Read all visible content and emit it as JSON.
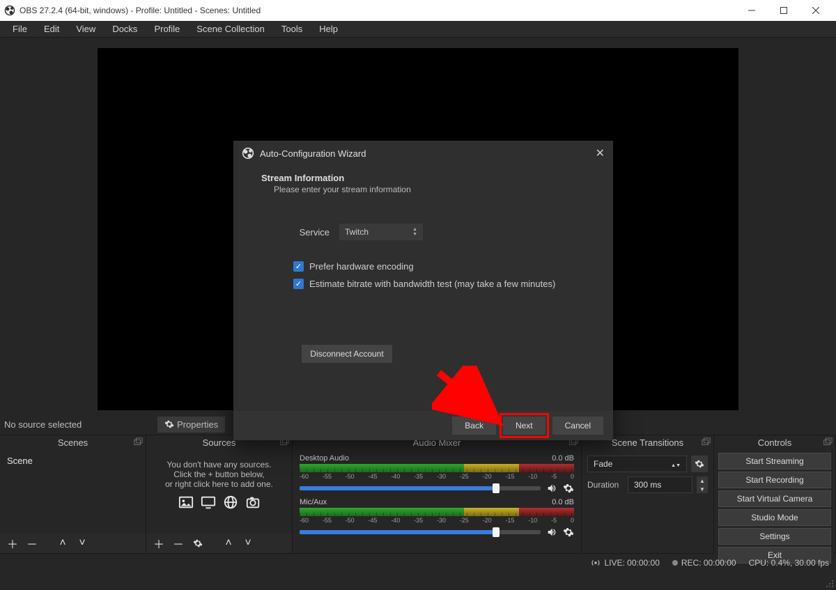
{
  "title": "OBS 27.2.4 (64-bit, windows) - Profile: Untitled - Scenes: Untitled",
  "menubar": {
    "items": [
      "File",
      "Edit",
      "View",
      "Docks",
      "Profile",
      "Scene Collection",
      "Tools",
      "Help"
    ]
  },
  "toolbar": {
    "no_source": "No source selected",
    "properties": "Properties"
  },
  "panels": {
    "scenes": {
      "title": "Scenes",
      "items": [
        "Scene"
      ]
    },
    "sources": {
      "title": "Sources",
      "empty_lines": [
        "You don't have any sources.",
        "Click the + button below,",
        "or right click here to add one."
      ]
    },
    "mixer": {
      "title": "Audio Mixer",
      "rows": [
        {
          "name": "Desktop Audio",
          "db": "0.0 dB",
          "scale": [
            "-60",
            "-55",
            "-50",
            "-45",
            "-40",
            "-35",
            "-30",
            "-25",
            "-20",
            "-15",
            "-10",
            "-5",
            "0"
          ]
        },
        {
          "name": "Mic/Aux",
          "db": "0.0 dB",
          "scale": [
            "-60",
            "-55",
            "-50",
            "-45",
            "-40",
            "-35",
            "-30",
            "-25",
            "-20",
            "-15",
            "-10",
            "-5",
            "0"
          ]
        }
      ]
    },
    "transitions": {
      "title": "Scene Transitions",
      "select": "Fade",
      "duration_label": "Duration",
      "duration": "300 ms"
    },
    "controls": {
      "title": "Controls",
      "buttons": [
        "Start Streaming",
        "Start Recording",
        "Start Virtual Camera",
        "Studio Mode",
        "Settings",
        "Exit"
      ]
    }
  },
  "status": {
    "live": "LIVE: 00:00:00",
    "rec": "REC: 00:00:00",
    "cpu": "CPU: 0.4%, 30.00 fps"
  },
  "modal": {
    "title": "Auto-Configuration Wizard",
    "heading": "Stream Information",
    "subtitle": "Please enter your stream information",
    "service_label": "Service",
    "service_value": "Twitch",
    "check1": "Prefer hardware encoding",
    "check2": "Estimate bitrate with bandwidth test (may take a few minutes)",
    "disconnect": "Disconnect Account",
    "back": "Back",
    "next": "Next",
    "cancel": "Cancel"
  }
}
